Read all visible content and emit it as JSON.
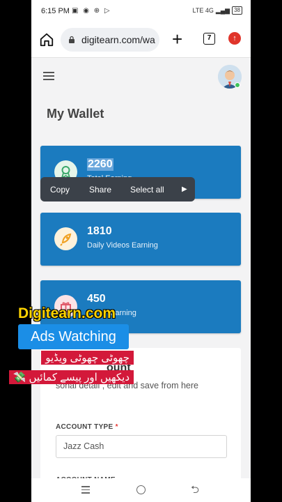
{
  "status_bar": {
    "time": "6:15 PM",
    "right": "LTE 4G",
    "battery": "38"
  },
  "browser": {
    "url": "digitearn.com/wa",
    "tabs_count": "7"
  },
  "page": {
    "title": "My Wallet"
  },
  "cards": [
    {
      "value": "2260",
      "label": "Total Earning"
    },
    {
      "value": "1810",
      "label": "Daily Videos Earning"
    },
    {
      "value": "450",
      "label": "Earning"
    }
  ],
  "context_menu": {
    "copy": "Copy",
    "share": "Share",
    "select_all": "Select all",
    "more": "▶"
  },
  "account": {
    "title": "ount",
    "description": "sonal detail , edit and save from here",
    "type_label": "ACCOUNT TYPE",
    "type_value": "Jazz Cash",
    "name_label": "ACCOUNT NAME"
  },
  "overlay": {
    "brand": "Digitearn.com",
    "tag": "Ads Watching",
    "urdu_line1": "چھوٹی چھوٹی ویڈیو",
    "urdu_line2": "دیکھیں اور پیسے کمائیں 💸"
  },
  "colors": {
    "card_blue": "#1b7bbf",
    "overlay_yellow": "#ffd400",
    "overlay_blue": "#1b8ee6",
    "overlay_red": "#d3193a"
  }
}
